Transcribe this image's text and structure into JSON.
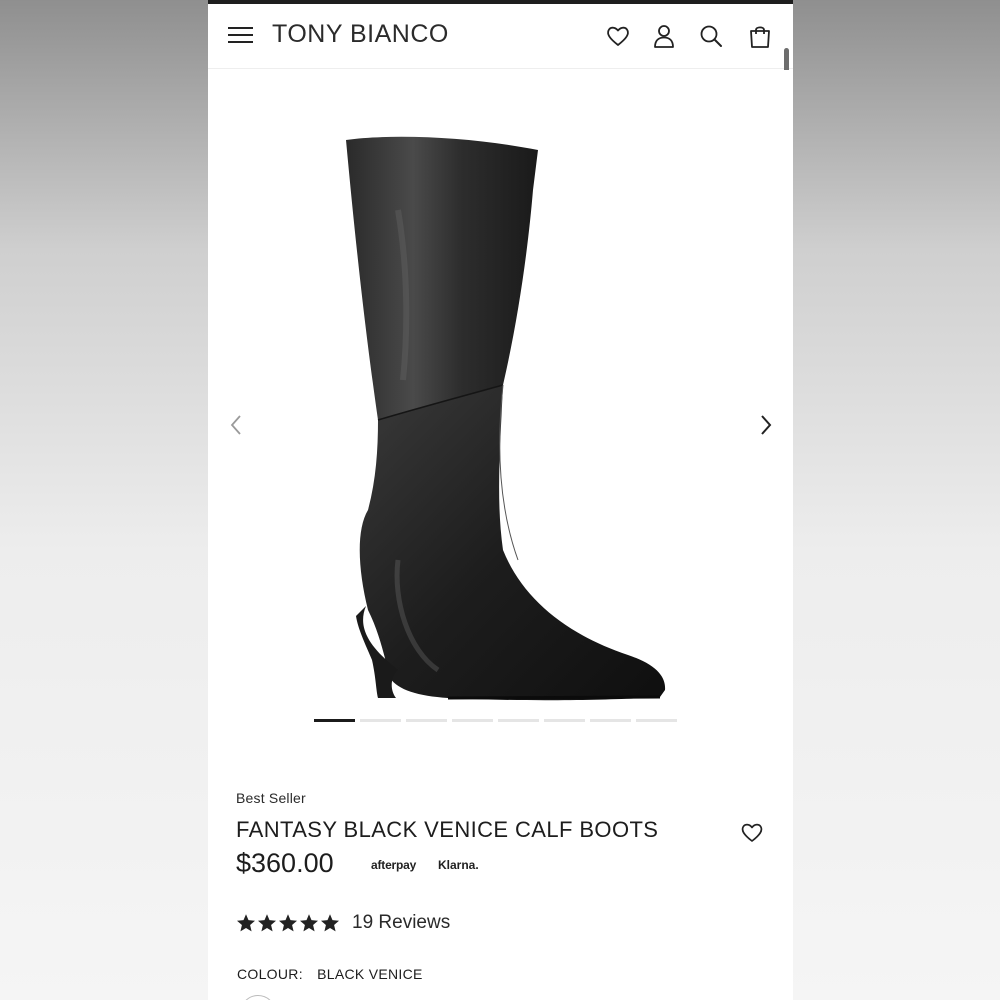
{
  "header": {
    "brand": "TONY BIANCO",
    "icons": [
      "menu-icon",
      "heart-icon",
      "user-icon",
      "search-icon",
      "bag-icon"
    ]
  },
  "gallery": {
    "total_images": 8,
    "active_index": 0,
    "prev_icon": "chevron-left-icon",
    "next_icon": "chevron-right-icon"
  },
  "product": {
    "badge": "Best Seller",
    "title": "FANTASY BLACK VENICE CALF BOOTS",
    "price": "$360.00",
    "payments": {
      "afterpay": "afterpay",
      "klarna": "Klarna."
    },
    "rating": {
      "stars": 5,
      "reviews_label": "19 Reviews"
    },
    "colour_label": "COLOUR:",
    "colour_value": "BLACK VENICE"
  },
  "colors": {
    "text": "#1d1d1d",
    "active_dot": "#1b1b1b",
    "inactive_dot": "#e5e5e5"
  }
}
